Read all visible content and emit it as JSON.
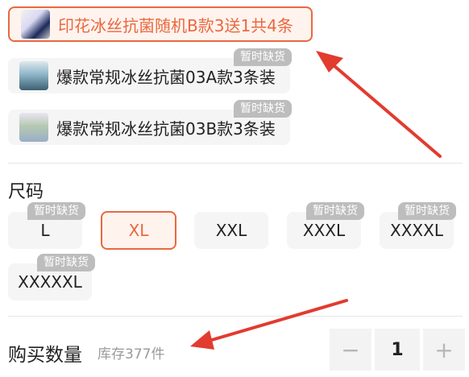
{
  "styles": {
    "options": [
      {
        "label": "印花冰丝抗菌随机B款3送1共4条",
        "selected": true
      },
      {
        "label": "爆款常规冰丝抗菌03A款3条装",
        "badge": "暂时缺货"
      },
      {
        "label": "爆款常规冰丝抗菌03B款3条装",
        "badge": "暂时缺货"
      }
    ]
  },
  "size": {
    "title": "尺码",
    "options": [
      {
        "label": "L",
        "badge": "暂时缺货"
      },
      {
        "label": "XL",
        "selected": true
      },
      {
        "label": "XXL"
      },
      {
        "label": "XXXL",
        "badge": "暂时缺货"
      },
      {
        "label": "XXXXL",
        "badge": "暂时缺货"
      },
      {
        "label": "XXXXXL",
        "badge": "暂时缺货"
      }
    ]
  },
  "quantity": {
    "label": "购买数量",
    "stock": "库存377件",
    "minus": "−",
    "value": "1",
    "plus": "+"
  },
  "colors": {
    "accent": "#e8693f",
    "arrow": "#e23b2f"
  },
  "icons": [
    "product-thumbnail",
    "annotation-arrow"
  ]
}
